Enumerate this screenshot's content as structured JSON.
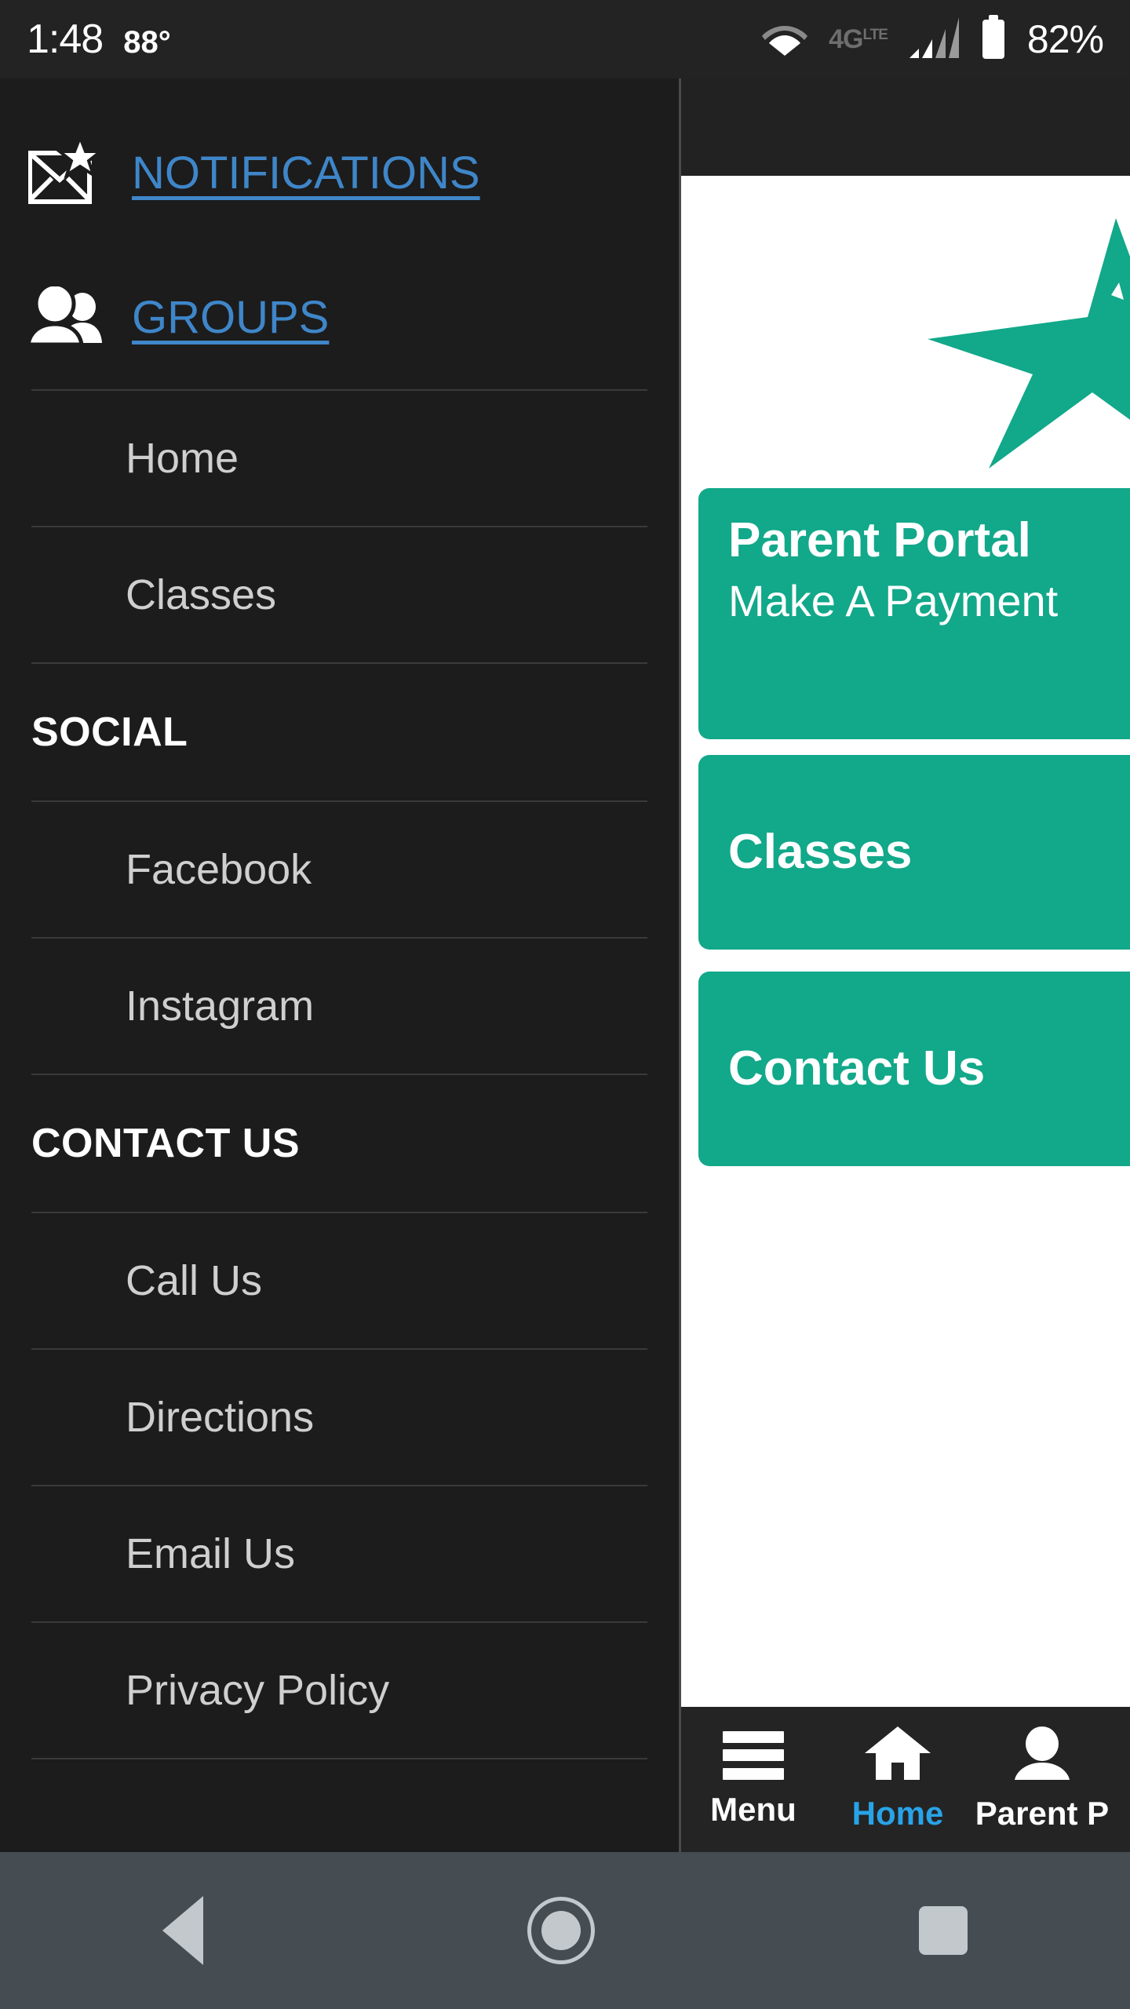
{
  "status_bar": {
    "time": "1:48",
    "temperature": "88°",
    "wifi_icon": "wifi-icon",
    "network_label": "4G",
    "network_sup": "LTE",
    "signal_icon": "signal-bars-icon",
    "battery_icon": "battery-icon",
    "battery_percent": "82%"
  },
  "drawer": {
    "top_links": [
      {
        "label": "NOTIFICATIONS",
        "icon": "envelope-star-icon"
      },
      {
        "label": "GROUPS",
        "icon": "people-group-icon"
      }
    ],
    "sections": [
      {
        "header": null,
        "items": [
          "Home",
          "Classes"
        ]
      },
      {
        "header": "SOCIAL",
        "items": [
          "Facebook",
          "Instagram"
        ]
      },
      {
        "header": "CONTACT US",
        "items": [
          "Call Us",
          "Directions",
          "Email Us",
          "Privacy Policy"
        ]
      }
    ]
  },
  "content": {
    "logo_icon": "star-logo",
    "tiles": [
      {
        "title": "Parent Portal",
        "subtitle": "Make A Payment"
      },
      {
        "title": "Classes",
        "subtitle": null
      },
      {
        "title": "Contact Us",
        "subtitle": null
      }
    ]
  },
  "tab_bar": {
    "tabs": [
      {
        "label": "Menu",
        "icon": "hamburger-icon",
        "active": false
      },
      {
        "label": "Home",
        "icon": "house-icon",
        "active": true
      },
      {
        "label": "Parent P",
        "icon": "person-icon",
        "active": false
      }
    ]
  },
  "android_nav": {
    "back": "back-triangle-icon",
    "home": "home-circle-icon",
    "recents": "recents-square-icon"
  },
  "colors": {
    "accent_teal": "#12a88a",
    "link_blue": "#3f86c9",
    "tab_active_blue": "#29a3e8",
    "drawer_bg": "#1c1c1c",
    "status_bg": "#232323",
    "android_nav_bg": "#454c52"
  }
}
